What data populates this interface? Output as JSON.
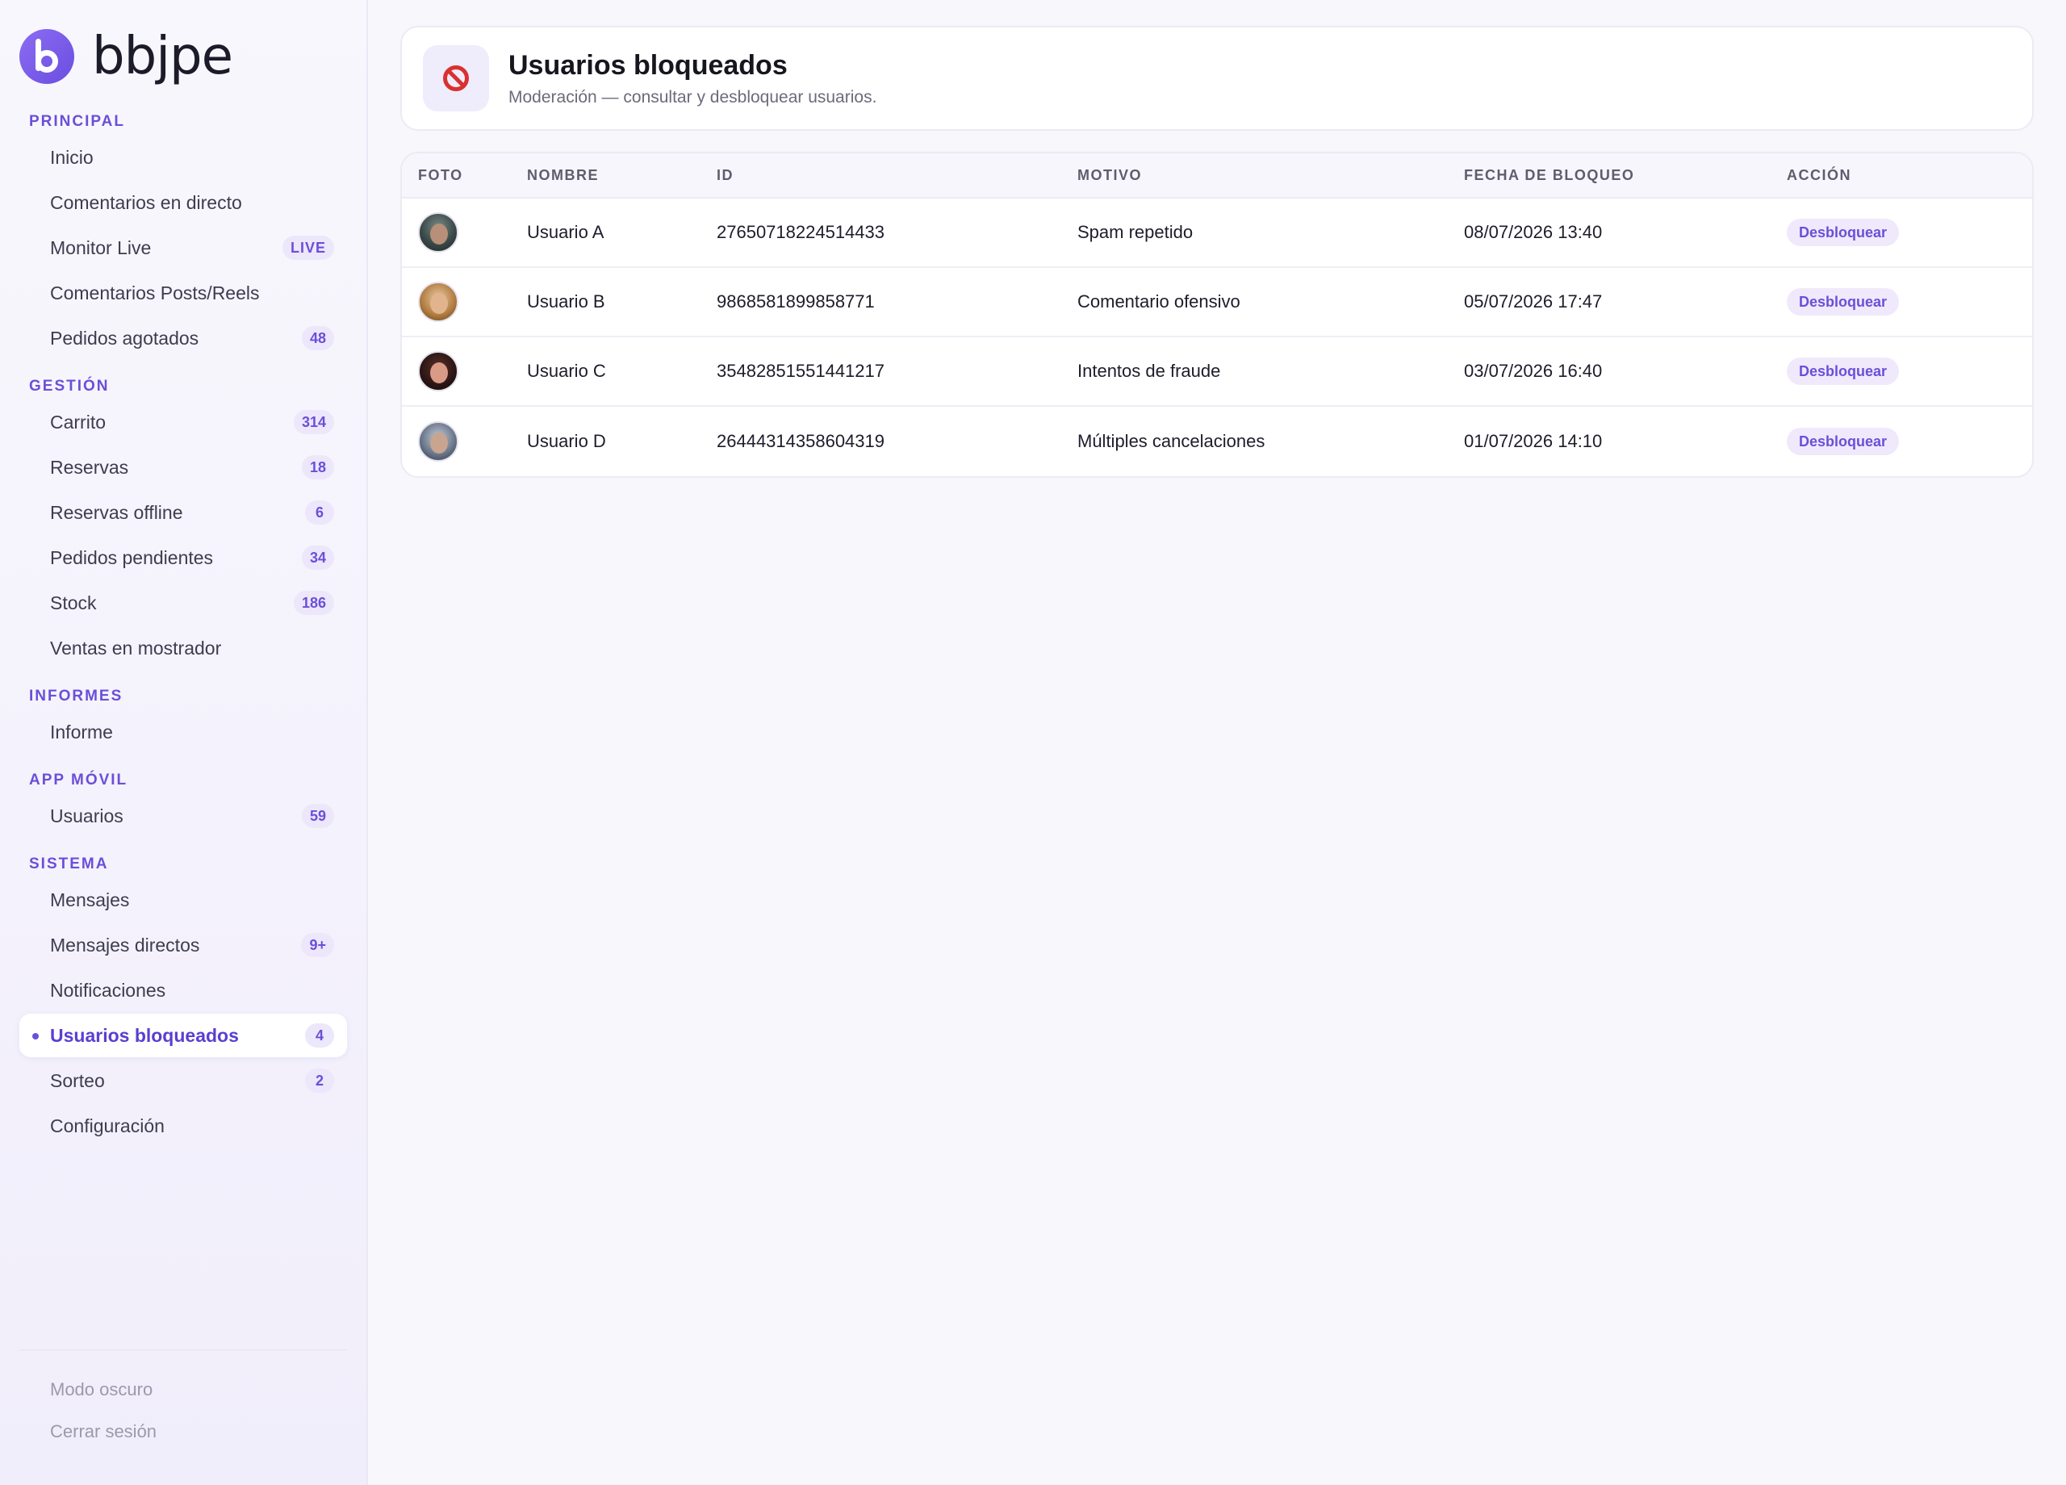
{
  "brand": {
    "name": "bbjpe"
  },
  "sidebar": {
    "sections": [
      {
        "title": "PRINCIPAL",
        "items": [
          {
            "label": "Inicio"
          },
          {
            "label": "Comentarios en directo"
          },
          {
            "label": "Monitor Live",
            "badge": "LIVE"
          },
          {
            "label": "Comentarios Posts/Reels"
          },
          {
            "label": "Pedidos agotados",
            "badge": "48"
          }
        ]
      },
      {
        "title": "GESTIÓN",
        "items": [
          {
            "label": "Carrito",
            "badge": "314"
          },
          {
            "label": "Reservas",
            "badge": "18"
          },
          {
            "label": "Reservas offline",
            "badge": "6"
          },
          {
            "label": "Pedidos pendientes",
            "badge": "34"
          },
          {
            "label": "Stock",
            "badge": "186"
          },
          {
            "label": "Ventas en mostrador"
          }
        ]
      },
      {
        "title": "INFORMES",
        "items": [
          {
            "label": "Informe"
          }
        ]
      },
      {
        "title": "APP MÓVIL",
        "items": [
          {
            "label": "Usuarios",
            "badge": "59"
          }
        ]
      },
      {
        "title": "SISTEMA",
        "items": [
          {
            "label": "Mensajes"
          },
          {
            "label": "Mensajes directos",
            "badge": "9+"
          },
          {
            "label": "Notificaciones"
          },
          {
            "label": "Usuarios bloqueados",
            "badge": "4",
            "active": true
          },
          {
            "label": "Sorteo",
            "badge": "2"
          },
          {
            "label": "Configuración"
          }
        ]
      }
    ],
    "footer": {
      "dark_mode": "Modo oscuro",
      "logout": "Cerrar sesión"
    }
  },
  "header": {
    "icon": "prohibited-icon",
    "title": "Usuarios bloqueados",
    "subtitle": "Moderación — consultar y desbloquear usuarios."
  },
  "table": {
    "columns": [
      "FOTO",
      "NOMBRE",
      "ID",
      "MOTIVO",
      "FECHA DE BLOQUEO",
      "ACCIÓN"
    ],
    "rows": [
      {
        "avatar": "avatar-photo",
        "nombre": "Usuario A",
        "id": "27650718224514433",
        "motivo": "Spam repetido",
        "fecha": "08/07/2026 13:40",
        "accion": "Desbloquear"
      },
      {
        "avatar": "avatar-photo",
        "nombre": "Usuario B",
        "id": "9868581899858771",
        "motivo": "Comentario ofensivo",
        "fecha": "05/07/2026 17:47",
        "accion": "Desbloquear"
      },
      {
        "avatar": "avatar-photo",
        "nombre": "Usuario C",
        "id": "35482851551441217",
        "motivo": "Intentos de fraude",
        "fecha": "03/07/2026 16:40",
        "accion": "Desbloquear"
      },
      {
        "avatar": "avatar-photo",
        "nombre": "Usuario D",
        "id": "26444314358604319",
        "motivo": "Múltiples cancelaciones",
        "fecha": "01/07/2026 14:10",
        "accion": "Desbloquear"
      }
    ]
  },
  "colors": {
    "accent": "#6b4fd8",
    "badge_bg": "#ece7fb",
    "sidebar_bg": "#f4f2fb",
    "page_bg": "#f7f7fc",
    "prohibited": "#d8312f"
  }
}
